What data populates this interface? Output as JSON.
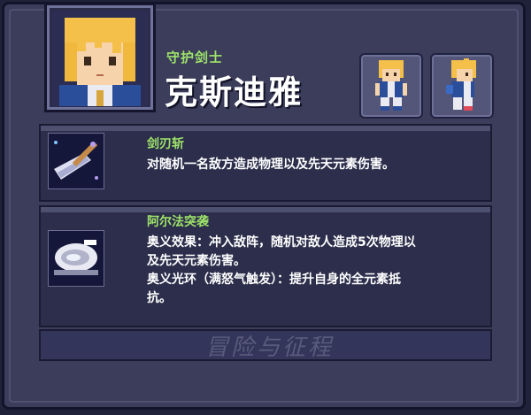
{
  "character": {
    "title": "守护剑士",
    "name": "克斯迪雅"
  },
  "skills": [
    {
      "name": "剑刃斩",
      "lines": [
        "对随机一名敌方造成物理以及先天元素伤害。"
      ]
    },
    {
      "name": "阿尔法突袭",
      "lines": [
        "奥义效果：冲入敌阵，随机对敌人造成5次物理以",
        "及先天元素伤害。",
        "奥义光环（满怒气触发）：提升自身的全元素抵",
        "抗。"
      ]
    }
  ],
  "logo": "冒险与征程",
  "colors": {
    "accent_green": "#9ee36a",
    "panel": "#3b3d5b",
    "text": "#ffffff"
  }
}
